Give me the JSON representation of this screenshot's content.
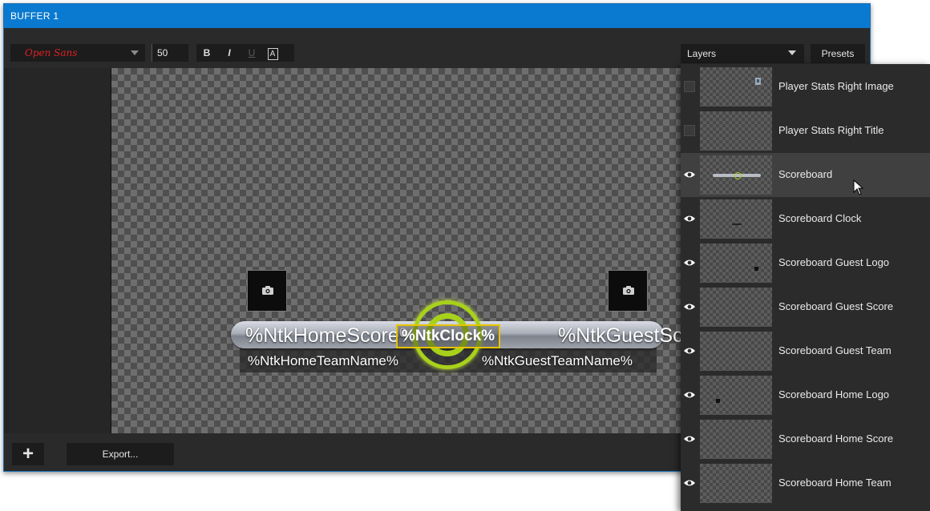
{
  "window": {
    "title": "BUFFER 1"
  },
  "toolbar": {
    "font_family": "Open Sans",
    "font_size": "50",
    "bold": "B",
    "italic": "I",
    "underline": "U",
    "outline": "A",
    "layers_select": "Layers",
    "presets_label": "Presets"
  },
  "canvas": {
    "home_score": "%NtkHomeScore%",
    "guest_score": "%NtkGuestScore%",
    "clock": "%NtkClock%",
    "home_team": "%NtkHomeTeamName%",
    "guest_team": "%NtkGuestTeamName%"
  },
  "bottombar": {
    "add_label": "+",
    "export_label": "Export..."
  },
  "layers": [
    {
      "name": "Player Stats Right Image",
      "visible": false
    },
    {
      "name": "Player Stats Right Title",
      "visible": false
    },
    {
      "name": "Scoreboard",
      "visible": true,
      "selected": true
    },
    {
      "name": "Scoreboard Clock",
      "visible": true
    },
    {
      "name": "Scoreboard Guest Logo",
      "visible": true
    },
    {
      "name": "Scoreboard Guest Score",
      "visible": true
    },
    {
      "name": "Scoreboard Guest Team",
      "visible": true
    },
    {
      "name": "Scoreboard Home Logo",
      "visible": true
    },
    {
      "name": "Scoreboard Home Score",
      "visible": true
    },
    {
      "name": "Scoreboard Home Team",
      "visible": true
    }
  ],
  "colors": {
    "titlebar": "#0a7ad0",
    "font_name": "#e02020",
    "ring": "#a8d21a",
    "clock_border": "#e7c400"
  }
}
